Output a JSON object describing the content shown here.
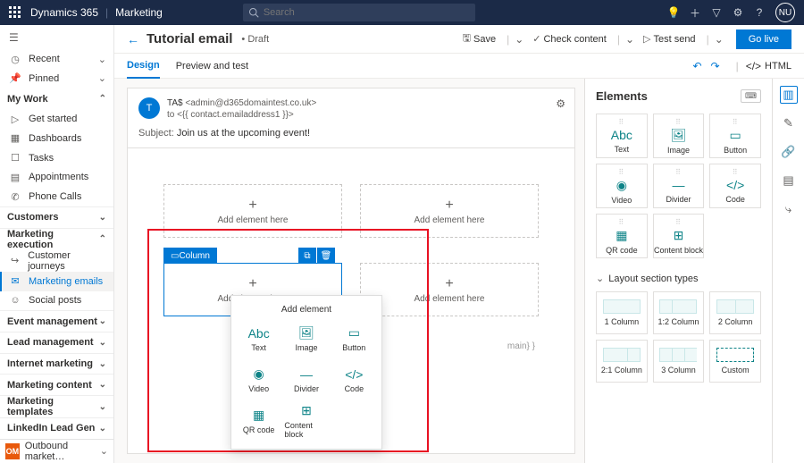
{
  "topbar": {
    "brand": "Dynamics 365",
    "app": "Marketing",
    "search_placeholder": "Search",
    "avatar": "NU"
  },
  "nav": {
    "recent": "Recent",
    "pinned": "Pinned",
    "mywork": {
      "label": "My Work",
      "items": [
        "Get started",
        "Dashboards",
        "Tasks",
        "Appointments",
        "Phone Calls"
      ]
    },
    "sections": [
      {
        "label": "Customers"
      },
      {
        "label": "Marketing execution",
        "items": [
          "Customer journeys",
          "Marketing emails",
          "Social posts"
        ],
        "selected": 1
      },
      {
        "label": "Event management"
      },
      {
        "label": "Lead management"
      },
      {
        "label": "Internet marketing"
      },
      {
        "label": "Marketing content"
      },
      {
        "label": "Marketing templates"
      },
      {
        "label": "LinkedIn Lead Gen"
      }
    ],
    "footer": {
      "badge": "OM",
      "label": "Outbound market…"
    }
  },
  "cmdbar": {
    "title": "Tutorial email",
    "status": "• Draft",
    "save": "Save",
    "check": "Check content",
    "test": "Test send",
    "golive": "Go live"
  },
  "tabs": {
    "design": "Design",
    "preview": "Preview and test",
    "html": "HTML"
  },
  "email": {
    "from_name": "TA$",
    "from_addr": "<admin@d365domaintest.co.uk>",
    "to": "to <{{ contact.emailaddress1 }}>",
    "subject_label": "Subject:",
    "subject": "Join us at the upcoming event!"
  },
  "canvas": {
    "add_here": "Add element here",
    "column": "Column",
    "domain_hint": "main} }"
  },
  "popup": {
    "title": "Add element",
    "items": [
      "Text",
      "Image",
      "Button",
      "Video",
      "Divider",
      "Code",
      "QR code",
      "Content block"
    ]
  },
  "sidepanel": {
    "title": "Elements",
    "elements": [
      "Text",
      "Image",
      "Button",
      "Video",
      "Divider",
      "Code",
      "QR code",
      "Content block"
    ],
    "layout_title": "Layout section types",
    "layouts": [
      "1 Column",
      "1:2 Column",
      "2 Column",
      "2:1 Column",
      "3 Column",
      "Custom"
    ]
  }
}
